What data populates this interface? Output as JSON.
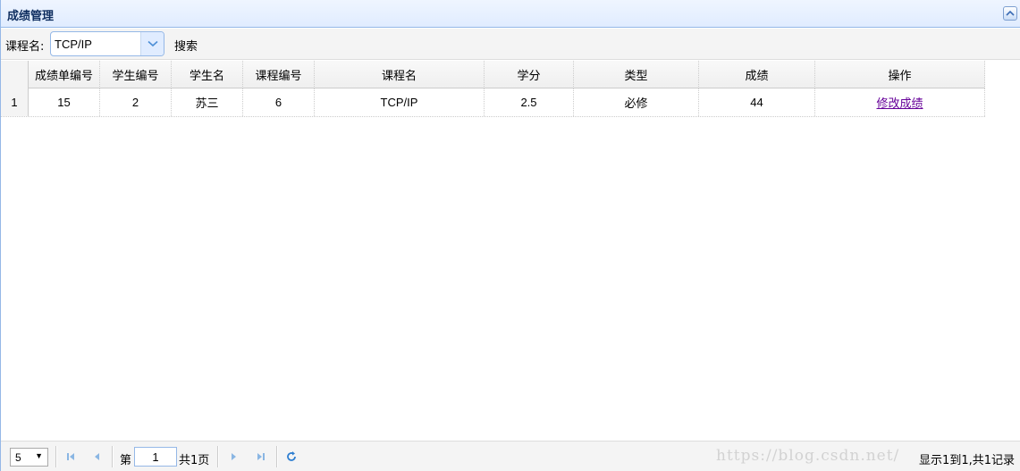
{
  "panel": {
    "title": "成绩管理"
  },
  "toolbar": {
    "course_label": "课程名:",
    "course_value": "TCP/IP",
    "search_label": "搜索"
  },
  "table": {
    "columns": [
      "成绩单编号",
      "学生编号",
      "学生名",
      "课程编号",
      "课程名",
      "学分",
      "类型",
      "成绩",
      "操作"
    ],
    "rows": [
      {
        "rownum": "1",
        "cells": [
          "15",
          "2",
          "苏三",
          "6",
          "TCP/IP",
          "2.5",
          "必修",
          "44"
        ],
        "action": "修改成绩"
      }
    ]
  },
  "pager": {
    "page_size": "5",
    "page_prefix": "第",
    "page_number": "1",
    "page_total": "共1页",
    "info": "显示1到1,共1记录",
    "watermark": "https://blog.csdn.net/"
  },
  "colors": {
    "header_border": "#95b8e7",
    "title_text": "#0e2d5f",
    "link": "#660099",
    "pager_icon": "#5a9bd5"
  }
}
